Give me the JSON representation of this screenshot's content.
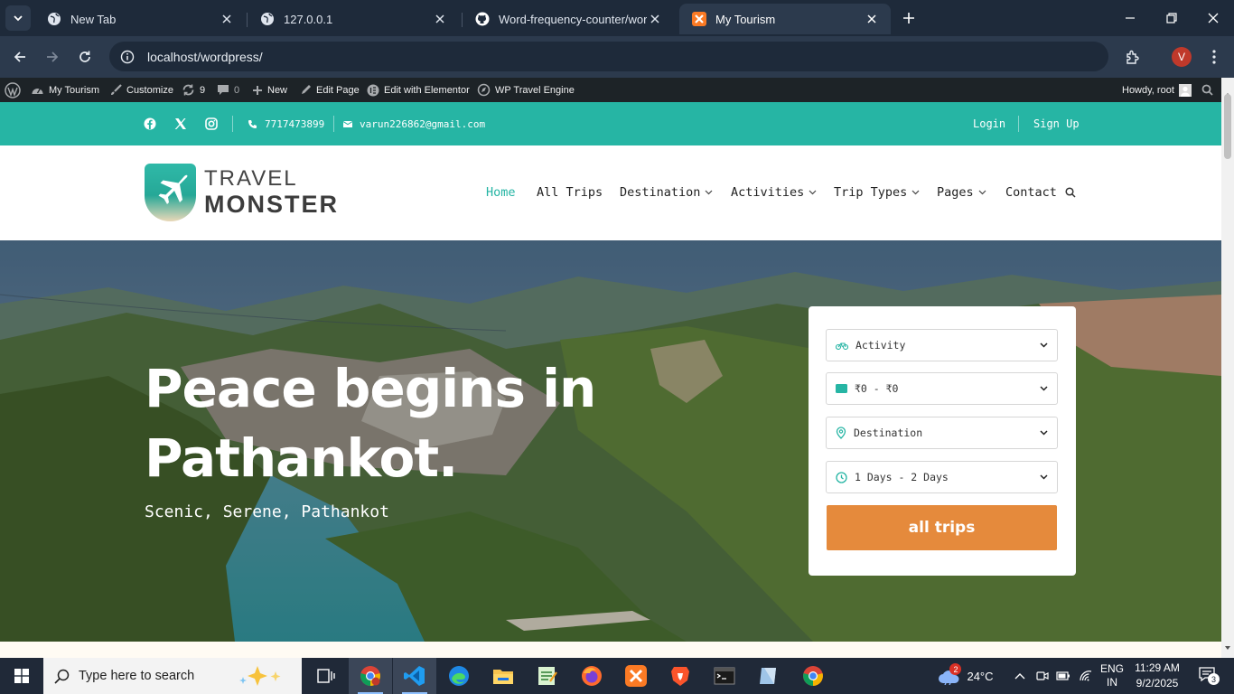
{
  "browser": {
    "tabs": [
      {
        "title": "New Tab",
        "icon": "globe-icon"
      },
      {
        "title": "127.0.0.1",
        "icon": "globe-icon"
      },
      {
        "title": "Word-frequency-counter/word",
        "icon": "github-icon"
      },
      {
        "title": "My Tourism",
        "icon": "xampp-icon"
      }
    ],
    "url": "localhost/wordpress/",
    "profile_initial": "V"
  },
  "adminbar": {
    "site_name": "My Tourism",
    "customize": "Customize",
    "updates_count": "9",
    "comments_count": "0",
    "new_label": "New",
    "edit_page": "Edit Page",
    "edit_elementor": "Edit with Elementor",
    "travel_engine": "WP Travel Engine",
    "howdy": "Howdy, root"
  },
  "topbar": {
    "phone": "7717473899",
    "email": "varun226862@gmail.com",
    "login": "Login",
    "signup": "Sign Up"
  },
  "header": {
    "logo_line1": "TRAVEL",
    "logo_line2": "MONSTER",
    "nav": [
      {
        "label": "Home",
        "active": true,
        "dropdown": false
      },
      {
        "label": "All Trips",
        "active": false,
        "dropdown": false
      },
      {
        "label": "Destination",
        "active": false,
        "dropdown": true
      },
      {
        "label": "Activities",
        "active": false,
        "dropdown": true
      },
      {
        "label": "Trip Types",
        "active": false,
        "dropdown": true
      },
      {
        "label": "Pages",
        "active": false,
        "dropdown": true
      },
      {
        "label": "Contact",
        "active": false,
        "dropdown": false
      }
    ]
  },
  "hero": {
    "title_line1": "Peace begins in",
    "title_line2": "Pathankot.",
    "subtitle": "Scenic, Serene, Pathankot"
  },
  "search": {
    "activity": "Activity",
    "price": "₹0 - ₹0",
    "destination": "Destination",
    "duration": "1 Days - 2 Days",
    "button": "all trips"
  },
  "taskbar": {
    "search_placeholder": "Type here to search",
    "weather": "24°C",
    "weather_badge": "2",
    "lang_line1": "ENG",
    "lang_line2": "IN",
    "time": "11:29 AM",
    "date": "9/2/2025",
    "notifications": "3"
  },
  "colors": {
    "accent_teal": "#26b5a4",
    "button_orange": "#e58a3c",
    "adminbar": "#1d2327",
    "browser_chrome": "#2c3a4d"
  }
}
